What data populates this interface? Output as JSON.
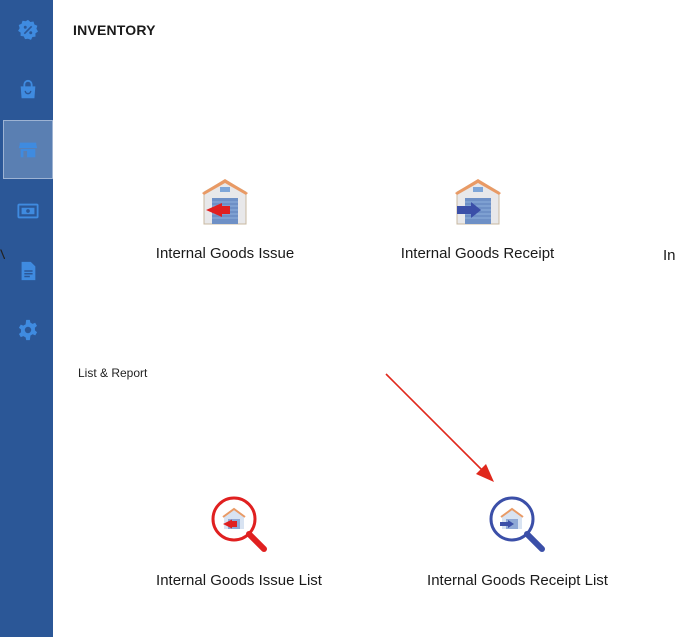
{
  "page": {
    "title": "INVENTORY"
  },
  "sidebar": {
    "items": [
      {
        "name": "discount-icon",
        "active": false
      },
      {
        "name": "shopping-bag-icon",
        "active": false
      },
      {
        "name": "store-icon",
        "active": true
      },
      {
        "name": "cash-icon",
        "active": false
      },
      {
        "name": "document-icon",
        "active": false
      },
      {
        "name": "gear-icon",
        "active": false
      }
    ],
    "edge_text": "V"
  },
  "transactions": {
    "issue_label": "Internal Goods Issue",
    "receipt_label": "Internal Goods Receipt",
    "truncated_label": "In"
  },
  "reports": {
    "section_label": "List & Report",
    "issue_list_label": "Internal Goods Issue List",
    "receipt_list_label": "Internal Goods Receipt List"
  },
  "colors": {
    "sidebar_bg": "#2b5797",
    "sidebar_active": "#5a7fb2",
    "issue_red": "#e02020",
    "receipt_blue": "#3b4fa8",
    "annotation_arrow": "#e0281c"
  }
}
